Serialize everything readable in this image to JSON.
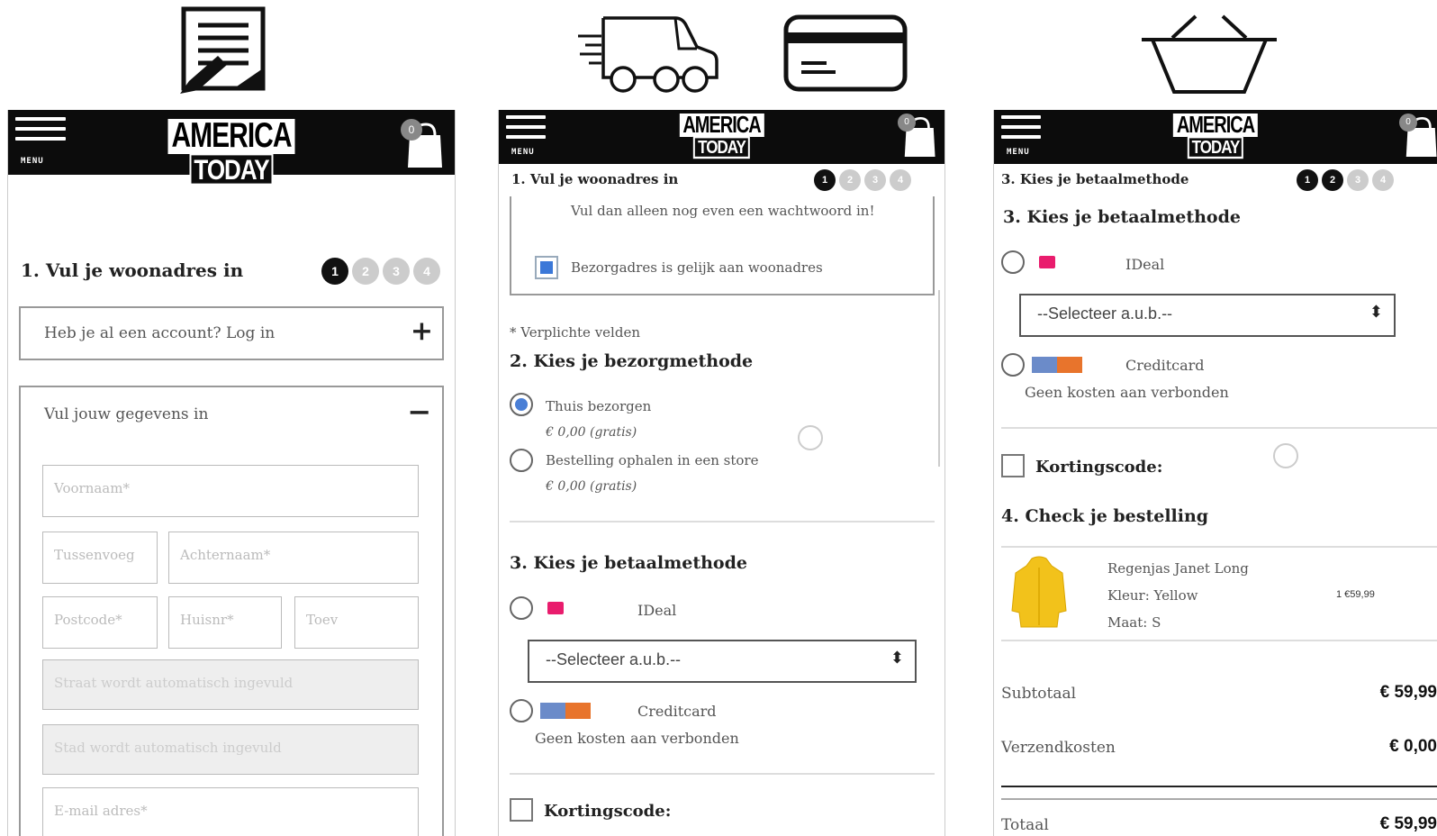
{
  "top_icons": [
    "form-edit-icon",
    "delivery-truck-icon",
    "credit-card-icon",
    "shopping-basket-icon"
  ],
  "brand": {
    "line1": "AMERICA",
    "line2": "TODAY",
    "menu_label": "MENU",
    "cart_count": "0"
  },
  "panel1": {
    "step_title": "1. Vul je woonadres in",
    "step_numbers": [
      "1",
      "2",
      "3",
      "4"
    ],
    "active_step": 1,
    "account_prompt": "Heb je al een account? Log in",
    "account_toggle": "+",
    "details_title": "Vul jouw gegevens in",
    "details_toggle": "−",
    "fields": {
      "voornaam": "Voornaam*",
      "tussenvoegsel": "Tussenvoeg",
      "achternaam": "Achternaam*",
      "postcode": "Postcode*",
      "huisnummer": "Huisnr*",
      "toevoeging": "Toev",
      "straat": "Straat wordt automatisch ingevuld",
      "stad": "Stad wordt automatisch ingevuld",
      "email": "E-mail adres*"
    }
  },
  "panel2": {
    "step_title": "1. Vul je woonadres in",
    "step_numbers": [
      "1",
      "2",
      "3",
      "4"
    ],
    "password_note": "Vul dan alleen nog even een wachtwoord in!",
    "same_address_label": "Bezorgadres is gelijk aan woonadres",
    "required_note": "* Verplichte velden",
    "delivery_heading": "2. Kies je bezorgmethode",
    "delivery_options": [
      {
        "label": "Thuis bezorgen",
        "price": "€ 0,00 (gratis)",
        "selected": true
      },
      {
        "label": "Bestelling ophalen in een store",
        "price": "€ 0,00 (gratis)",
        "selected": false
      }
    ],
    "payment_heading": "3. Kies je betaalmethode",
    "ideal_label": "IDeal",
    "select_placeholder": "--Selecteer a.u.b.--",
    "creditcard_label": "Creditcard",
    "creditcard_note": "Geen kosten aan verbonden",
    "discount_label": "Kortingscode:"
  },
  "panel3": {
    "step_title": "3. Kies je betaalmethode",
    "step_numbers": [
      "1",
      "2",
      "3",
      "4"
    ],
    "payment_heading": "3. Kies je betaalmethode",
    "ideal_label": "IDeal",
    "select_placeholder": "--Selecteer a.u.b.--",
    "creditcard_label": "Creditcard",
    "creditcard_note": "Geen kosten aan verbonden",
    "discount_label": "Kortingscode:",
    "check_heading": "4. Check je bestelling",
    "product": {
      "name": "Regenjas Janet Long",
      "color": "Kleur: Yellow",
      "size": "Maat: S",
      "qty_price": "1 €59,99",
      "color_hex": "#f2c21b"
    },
    "subtotal_label": "Subtotaal",
    "subtotal_value": "€ 59,99",
    "shipping_label": "Verzendkosten",
    "shipping_value": "€ 0,00",
    "total_label": "Totaal",
    "total_value": "€ 59,99"
  },
  "colors": {
    "header": "#0c0c0c",
    "radio_accent": "#4a7fd6",
    "ideal": "#e91c6d",
    "step_active": "#111",
    "step_inactive": "#cccccc"
  }
}
